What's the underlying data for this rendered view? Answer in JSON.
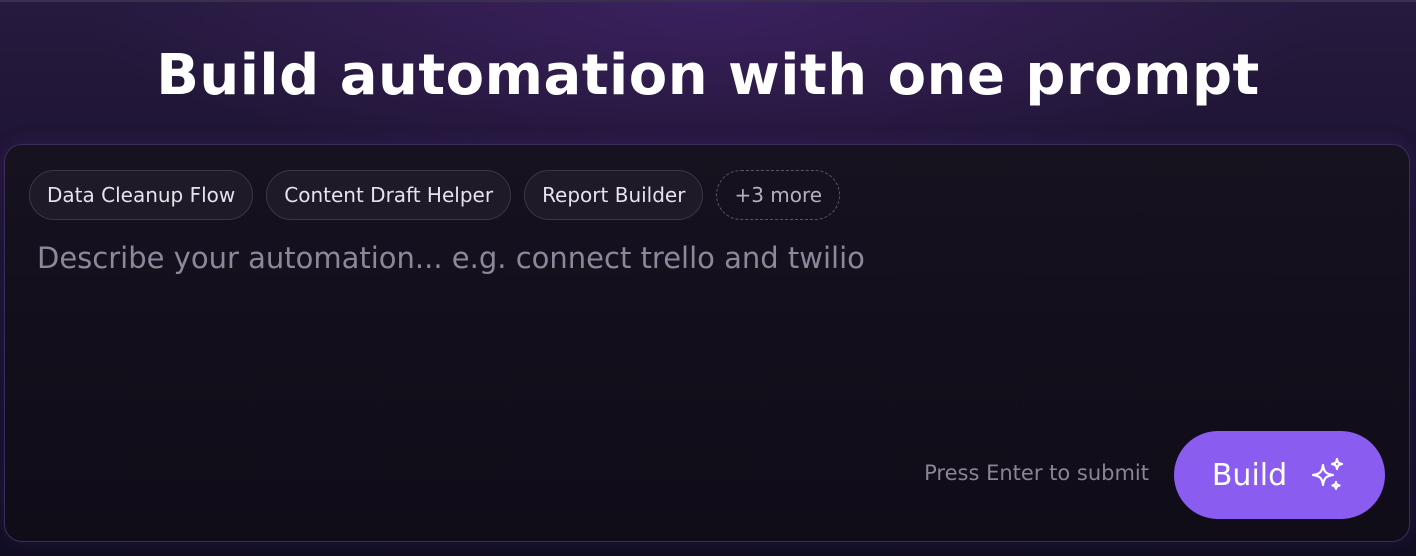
{
  "page": {
    "title": "Build automation with one prompt"
  },
  "templates": {
    "chips": [
      {
        "label": "Data Cleanup Flow"
      },
      {
        "label": "Content Draft Helper"
      },
      {
        "label": "Report Builder"
      }
    ],
    "more_label": "+3 more"
  },
  "prompt": {
    "value": "",
    "placeholder": "Describe your automation... e.g. connect trello and twilio"
  },
  "footer": {
    "hint": "Press Enter to submit",
    "build_label": "Build",
    "build_icon": "sparkles-icon"
  },
  "colors": {
    "accent": "#8a5cf0",
    "background": "#14101f",
    "panel": "#120e1b"
  }
}
